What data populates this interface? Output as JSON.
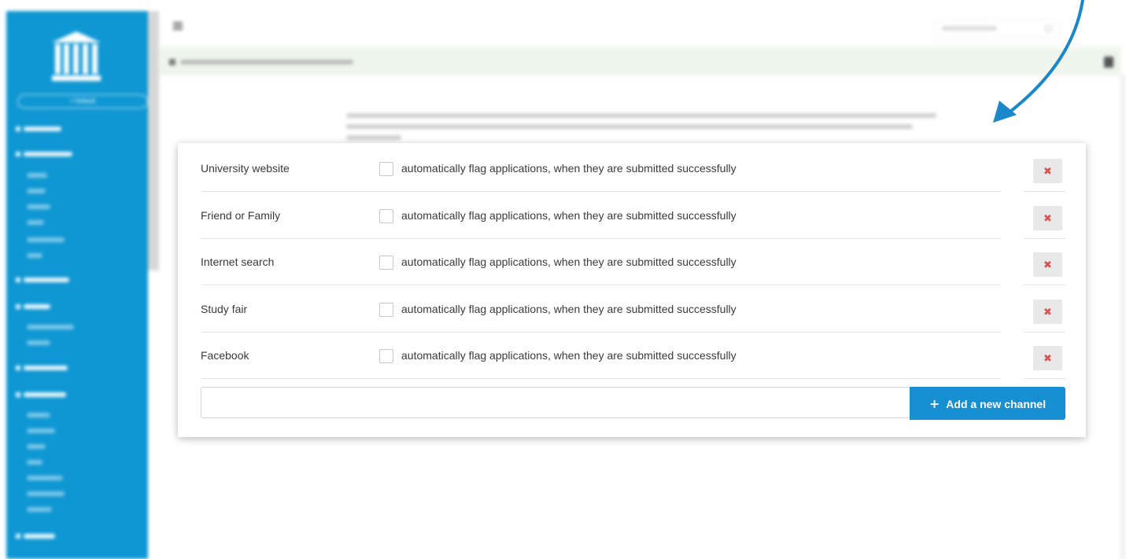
{
  "sidebar": {
    "search_label": "× Default"
  },
  "channels": [
    {
      "name": "University website",
      "flag_label": "automatically flag applications, when they are submitted successfully",
      "flag_checked": false
    },
    {
      "name": "Friend or Family",
      "flag_label": "automatically flag applications, when they are submitted successfully",
      "flag_checked": false
    },
    {
      "name": "Internet search",
      "flag_label": "automatically flag applications, when they are submitted successfully",
      "flag_checked": false
    },
    {
      "name": "Study fair",
      "flag_label": "automatically flag applications, when they are submitted successfully",
      "flag_checked": false
    },
    {
      "name": "Facebook",
      "flag_label": "automatically flag applications, when they are submitted successfully",
      "flag_checked": false
    }
  ],
  "delete_glyph": "✖",
  "new_channel": {
    "value": "",
    "button_plus": "+",
    "button_label": "Add a new channel"
  },
  "colors": {
    "sidebar": "#0f97d3",
    "primary_button": "#1690d2",
    "delete_icon": "#d9534f",
    "arrow": "#1b87c9"
  },
  "icons": [
    "menu-icon",
    "search-icon",
    "home-icon",
    "book-icon",
    "delete-icon",
    "plus-icon",
    "arrow-icon"
  ]
}
